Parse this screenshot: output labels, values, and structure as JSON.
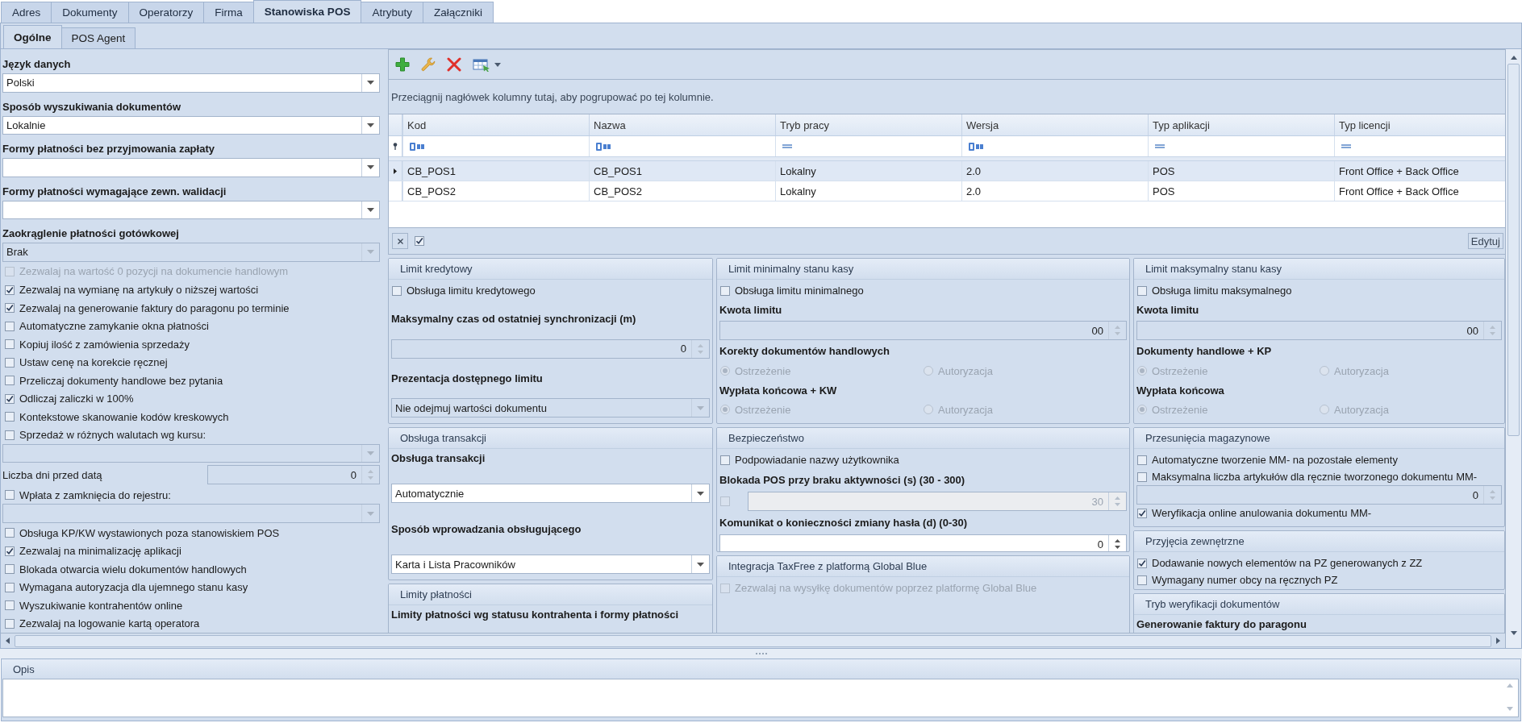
{
  "tabs": [
    {
      "label": "Adres",
      "selected": false
    },
    {
      "label": "Dokumenty",
      "selected": false
    },
    {
      "label": "Operatorzy",
      "selected": false
    },
    {
      "label": "Firma",
      "selected": false
    },
    {
      "label": "Stanowiska POS",
      "selected": true
    },
    {
      "label": "Atrybuty",
      "selected": false
    },
    {
      "label": "Załączniki",
      "selected": false
    }
  ],
  "subtabs": [
    {
      "label": "Ogólne",
      "selected": true
    },
    {
      "label": "POS Agent",
      "selected": false
    }
  ],
  "general_settings": [
    {
      "kind": "heading",
      "label": "Język danych"
    },
    {
      "kind": "select",
      "value": "Polski",
      "disabled": false
    },
    {
      "kind": "heading",
      "label": "Sposób wyszukiwania dokumentów"
    },
    {
      "kind": "select",
      "value": "Lokalnie",
      "disabled": false
    },
    {
      "kind": "heading",
      "label": "Formy płatności bez przyjmowania zapłaty"
    },
    {
      "kind": "select",
      "disabled": false
    },
    {
      "kind": "heading",
      "label": "Formy płatności wymagające zewn. walidacji"
    },
    {
      "kind": "select",
      "disabled": false
    },
    {
      "kind": "heading",
      "label": "Zaokrąglenie płatności gotówkowej"
    },
    {
      "kind": "select",
      "value": "Brak",
      "disabled": true
    },
    {
      "kind": "checkbox",
      "label": "Zezwalaj na wartość 0 pozycji na dokumencie handlowym",
      "checked": false,
      "disabled": true
    },
    {
      "kind": "checkbox",
      "label": "Zezwalaj na wymianę na artykuły o niższej wartości",
      "checked": true,
      "disabled": false
    },
    {
      "kind": "checkbox",
      "label": "Zezwalaj na generowanie faktury do paragonu po terminie",
      "checked": true,
      "disabled": false
    },
    {
      "kind": "checkbox",
      "label": "Automatyczne zamykanie okna płatności",
      "checked": false,
      "disabled": false
    },
    {
      "kind": "checkbox",
      "label": "Kopiuj ilość z zamówienia sprzedaży",
      "checked": false,
      "disabled": false
    },
    {
      "kind": "checkbox",
      "label": "Ustaw cenę na korekcie ręcznej",
      "checked": false,
      "disabled": false
    },
    {
      "kind": "checkbox",
      "label": "Przeliczaj dokumenty handlowe bez pytania",
      "checked": false,
      "disabled": false
    },
    {
      "kind": "checkbox",
      "label": "Odliczaj zaliczki w 100%",
      "checked": true,
      "disabled": false
    },
    {
      "kind": "checkbox",
      "label": "Kontekstowe skanowanie kodów kreskowych",
      "checked": false,
      "disabled": false
    },
    {
      "kind": "checkbox",
      "label": "Sprzedaż w różnych walutach wg kursu:",
      "checked": false,
      "disabled": false
    },
    {
      "kind": "select",
      "disabled": true
    },
    {
      "kind": "number",
      "label": "Liczba dni przed datą",
      "value": "0",
      "disabled": true
    },
    {
      "kind": "checkbox",
      "label": "Wpłata z zamknięcia do rejestru:",
      "checked": false,
      "disabled": false
    },
    {
      "kind": "select",
      "disabled": true
    },
    {
      "kind": "checkbox",
      "label": "Obsługa KP/KW wystawionych poza stanowiskiem POS",
      "checked": false,
      "disabled": false
    },
    {
      "kind": "checkbox",
      "label": "Zezwalaj na minimalizację aplikacji",
      "checked": true,
      "disabled": false
    },
    {
      "kind": "checkbox",
      "label": "Blokada otwarcia wielu dokumentów handlowych",
      "checked": false,
      "disabled": false
    },
    {
      "kind": "checkbox",
      "label": "Wymagana autoryzacja dla ujemnego stanu kasy",
      "checked": false,
      "disabled": false
    },
    {
      "kind": "checkbox",
      "label": "Wyszukiwanie kontrahentów online",
      "checked": false,
      "disabled": false
    },
    {
      "kind": "checkbox",
      "label": "Zezwalaj na logowanie kartą operatora",
      "checked": false,
      "disabled": false
    }
  ],
  "grid": {
    "group_hint": "Przeciągnij nagłówek kolumny tutaj, aby pogrupować po tej kolumnie.",
    "columns": [
      {
        "label": "Kod",
        "kind": "text"
      },
      {
        "label": "Nazwa",
        "kind": "text"
      },
      {
        "label": "Tryb pracy",
        "kind": "equals"
      },
      {
        "label": "Wersja",
        "kind": "text"
      },
      {
        "label": "Typ aplikacji",
        "kind": "equals"
      },
      {
        "label": "Typ licencji",
        "kind": "equals"
      }
    ],
    "rows": [
      {
        "selected": true,
        "cells": [
          "CB_POS1",
          "CB_POS1",
          "Lokalny",
          "2.0",
          "POS",
          "Front Office + Back Office"
        ]
      },
      {
        "selected": false,
        "cells": [
          "CB_POS2",
          "CB_POS2",
          "Lokalny",
          "2.0",
          "POS",
          "Front Office + Back Office"
        ]
      }
    ],
    "filter_enabled": true,
    "edit_button": "Edytuj"
  },
  "section_columns": [
    {
      "groups": [
        {
          "title": "Limit kredytowy",
          "items": [
            {
              "kind": "checkbox",
              "label": "Obsługa limitu kredytowego",
              "checked": false,
              "disabled": false
            },
            {
              "kind": "heading",
              "label": "Maksymalny czas od ostatniej synchronizacji (m)"
            },
            {
              "kind": "spin",
              "value": "0",
              "disabled": true
            },
            {
              "kind": "heading",
              "label": "Prezentacja dostępnego limitu"
            },
            {
              "kind": "select",
              "value": "Nie odejmuj wartości dokumentu",
              "disabled": true
            }
          ]
        },
        {
          "title": "Obsługa transakcji",
          "items": [
            {
              "kind": "heading",
              "label": "Obsługa transakcji"
            },
            {
              "kind": "select",
              "value": "Automatycznie",
              "disabled": false
            },
            {
              "kind": "heading",
              "label": "Sposób wprowadzania obsługującego"
            },
            {
              "kind": "select",
              "value": "Karta i Lista Pracowników",
              "disabled": false
            }
          ]
        },
        {
          "title": "Limity płatności",
          "items": [
            {
              "kind": "heading",
              "label": "Limity płatności wg statusu kontrahenta i formy płatności"
            }
          ]
        }
      ]
    },
    {
      "groups": [
        {
          "title": "Limit minimalny stanu kasy",
          "items": [
            {
              "kind": "checkbox",
              "label": "Obsługa limitu minimalnego",
              "checked": false,
              "disabled": false
            },
            {
              "kind": "heading",
              "label": "Kwota limitu"
            },
            {
              "kind": "spin",
              "value": "00",
              "disabled": true
            },
            {
              "kind": "heading",
              "label": "Korekty dokumentów handlowych"
            },
            {
              "kind": "radios",
              "disabled": true,
              "options": [
                {
                  "label": "Ostrzeżenie",
                  "selected": true
                },
                {
                  "label": "Autoryzacja",
                  "selected": false
                }
              ]
            },
            {
              "kind": "heading",
              "label": "Wypłata końcowa + KW"
            },
            {
              "kind": "radios",
              "disabled": true,
              "options": [
                {
                  "label": "Ostrzeżenie",
                  "selected": true
                },
                {
                  "label": "Autoryzacja",
                  "selected": false
                }
              ]
            }
          ]
        },
        {
          "title": "Bezpieczeństwo",
          "items": [
            {
              "kind": "checkbox",
              "label": "Podpowiadanie nazwy użytkownika",
              "checked": false,
              "disabled": false
            },
            {
              "kind": "heading",
              "label": "Blokada POS przy braku aktywności (s) (30 - 300)"
            },
            {
              "kind": "check_spin",
              "checked": false,
              "value": "30",
              "disabled": true
            },
            {
              "kind": "heading",
              "label": "Komunikat o konieczności zmiany hasła (d) (0-30)"
            },
            {
              "kind": "spin",
              "value": "0",
              "disabled": false
            }
          ]
        },
        {
          "title": "Integracja TaxFree z platformą Global Blue",
          "items": [
            {
              "kind": "checkbox",
              "label": "Zezwalaj na wysyłkę dokumentów poprzez platformę Global Blue",
              "checked": false,
              "disabled": true
            }
          ]
        }
      ]
    },
    {
      "groups": [
        {
          "title": "Limit maksymalny stanu kasy",
          "items": [
            {
              "kind": "checkbox",
              "label": "Obsługa limitu maksymalnego",
              "checked": false,
              "disabled": false
            },
            {
              "kind": "heading",
              "label": "Kwota limitu"
            },
            {
              "kind": "spin",
              "value": "00",
              "disabled": true
            },
            {
              "kind": "heading",
              "label": "Dokumenty handlowe + KP"
            },
            {
              "kind": "radios",
              "disabled": true,
              "options": [
                {
                  "label": "Ostrzeżenie",
                  "selected": true
                },
                {
                  "label": "Autoryzacja",
                  "selected": false
                }
              ]
            },
            {
              "kind": "heading",
              "label": "Wypłata końcowa"
            },
            {
              "kind": "radios",
              "disabled": true,
              "options": [
                {
                  "label": "Ostrzeżenie",
                  "selected": true
                },
                {
                  "label": "Autoryzacja",
                  "selected": false
                }
              ]
            }
          ]
        },
        {
          "title": "Przesunięcia magazynowe",
          "items": [
            {
              "kind": "checkbox",
              "label": "Automatyczne tworzenie MM- na pozostałe elementy",
              "checked": false,
              "disabled": false
            },
            {
              "kind": "checkbox",
              "label": "Maksymalna liczba artykułów dla ręcznie tworzonego dokumentu MM-",
              "checked": false,
              "disabled": false
            },
            {
              "kind": "spin",
              "value": "0",
              "disabled": true
            },
            {
              "kind": "checkbox",
              "label": "Weryfikacja online anulowania dokumentu MM-",
              "checked": true,
              "disabled": false
            }
          ]
        },
        {
          "title": "Przyjęcia zewnętrzne",
          "items": [
            {
              "kind": "checkbox",
              "label": "Dodawanie nowych elementów na PZ generowanych z ZZ",
              "checked": true,
              "disabled": false
            },
            {
              "kind": "checkbox",
              "label": "Wymagany numer obcy na ręcznych PZ",
              "checked": false,
              "disabled": false
            }
          ]
        },
        {
          "title": "Tryb weryfikacji dokumentów",
          "items": [
            {
              "kind": "heading",
              "label": "Generowanie faktury do paragonu"
            }
          ]
        }
      ]
    }
  ],
  "description": {
    "title": "Opis"
  }
}
